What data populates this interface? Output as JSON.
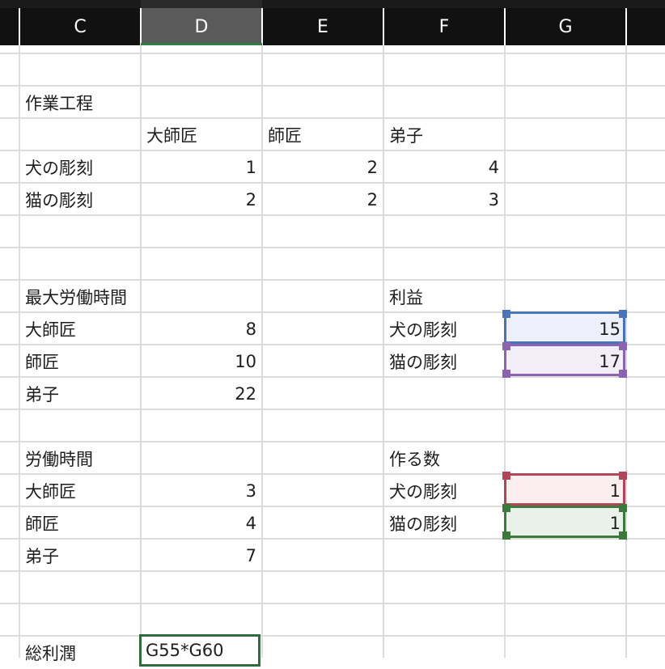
{
  "columns": [
    "C",
    "D",
    "E",
    "F",
    "G"
  ],
  "rows": {
    "r1": {
      "c": "作業工程"
    },
    "r2": {
      "d": "大師匠",
      "e": "師匠",
      "f": "弟子"
    },
    "r3": {
      "c": "犬の彫刻",
      "d": "1",
      "e": "2",
      "f": "4"
    },
    "r4": {
      "c": "猫の彫刻",
      "d": "2",
      "e": "2",
      "f": "3"
    },
    "r7": {
      "c": "最大労働時間",
      "f": "利益"
    },
    "r8": {
      "c": "大師匠",
      "d": "8",
      "f": "犬の彫刻",
      "g": "15"
    },
    "r9": {
      "c": "師匠",
      "d": "10",
      "f": "猫の彫刻",
      "g": "17"
    },
    "r10": {
      "c": "弟子",
      "d": "22"
    },
    "r12": {
      "c": "労働時間",
      "f": "作る数"
    },
    "r13": {
      "c": "大師匠",
      "d": "3",
      "f": "犬の彫刻",
      "g": "1"
    },
    "r14": {
      "c": "師匠",
      "d": "4",
      "f": "猫の彫刻",
      "g": "1"
    },
    "r15": {
      "c": "弟子",
      "d": "7"
    },
    "r18": {
      "c": "総利潤"
    }
  },
  "active_cell": {
    "formula": "G55*G60"
  },
  "highlight_colors": {
    "blue": "#4a73b8",
    "purple": "#8b63b0",
    "red": "#b0465a",
    "green": "#3c7a3c",
    "active_border": "#2f6e3c"
  }
}
